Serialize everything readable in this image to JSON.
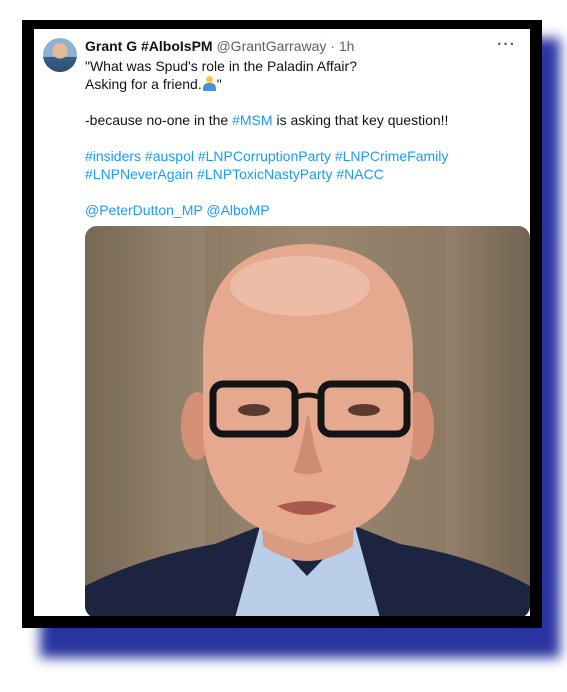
{
  "tweet": {
    "display_name": "Grant G #AlboIsPM",
    "handle": "@GrantGarraway",
    "separator": "·",
    "time": "1h",
    "more_label": "···",
    "line1": "\"What was Spud's role in the Paladin Affair?",
    "line2_text": "Asking for a friend.",
    "line2_end": "\"",
    "line3_pre": "-because no-one in the ",
    "line3_link": "#MSM",
    "line3_post": " is asking that key question!!",
    "hashtags_row1": [
      "#insiders",
      "#auspol",
      "#LNPCorruptionParty",
      "#LNPCrimeFamily"
    ],
    "hashtags_row2": [
      "#LNPNeverAgain",
      "#LNPToxicNastyParty",
      "#NACC"
    ],
    "mentions": [
      "@PeterDutton_MP",
      "@AlboMP"
    ]
  },
  "colors": {
    "link": "#1d9bf0",
    "frame": "#000000",
    "shadow": "#1f2a9c"
  },
  "icons": {
    "emoji": "person-shrugging-icon",
    "more": "more-options-icon"
  }
}
